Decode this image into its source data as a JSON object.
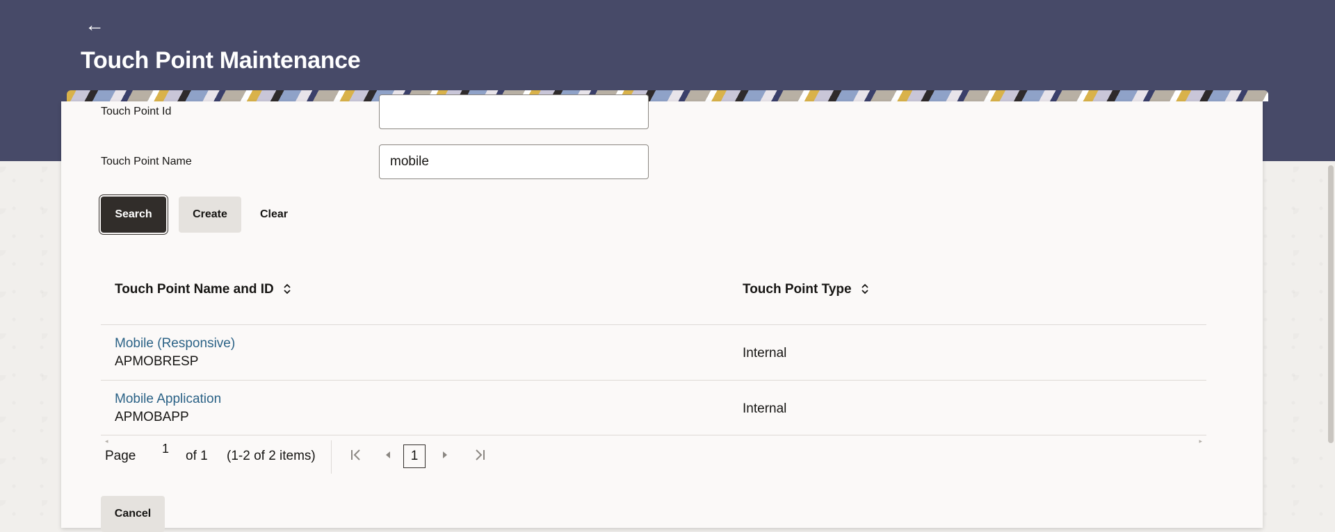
{
  "header": {
    "back_icon": "←",
    "title": "Touch Point Maintenance"
  },
  "form": {
    "touch_point_id_label": "Touch Point Id",
    "touch_point_id_value": "",
    "touch_point_name_label": "Touch Point Name",
    "touch_point_name_value": "mobile"
  },
  "buttons": {
    "search": "Search",
    "create": "Create",
    "clear": "Clear",
    "cancel": "Cancel"
  },
  "table": {
    "columns": [
      "Touch Point Name and ID",
      "Touch Point Type"
    ],
    "sort_icon": "⌃⌄",
    "rows": [
      {
        "name": "Mobile (Responsive)",
        "id": "APMOBRESP",
        "type": "Internal"
      },
      {
        "name": "Mobile Application",
        "id": "APMOBAPP",
        "type": "Internal"
      }
    ]
  },
  "pagination": {
    "page_label": "Page",
    "page_value": "1",
    "of_label": "of 1",
    "items_label": "(1-2 of 2 items)",
    "current_page": "1",
    "first_icon": "|<",
    "prev_icon": "◀",
    "next_icon": "▶",
    "last_icon": ">|"
  },
  "colors": {
    "header": "#474a68",
    "primary_button": "#312d2a",
    "link": "#2b6286"
  }
}
